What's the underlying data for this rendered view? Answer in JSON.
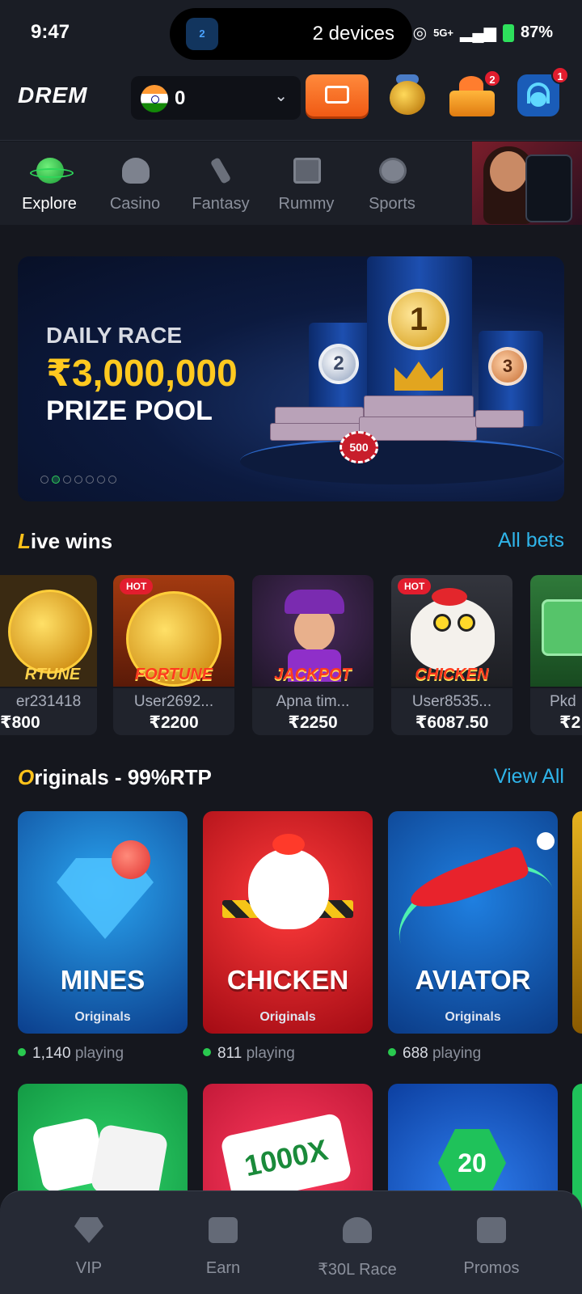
{
  "status_bar": {
    "time": "9:47",
    "island_text": "2 devices",
    "island_badge": "2",
    "network": "5G+",
    "battery": "87%"
  },
  "header": {
    "logo": "DREM",
    "balance": "0",
    "jar_icon": "gold-jar-icon",
    "gift_badge": "2",
    "support_badge": "1"
  },
  "categories": [
    {
      "label": "Explore",
      "active": true
    },
    {
      "label": "Casino",
      "active": false
    },
    {
      "label": "Fantasy",
      "active": false
    },
    {
      "label": "Rummy",
      "active": false
    },
    {
      "label": "Sports",
      "active": false
    }
  ],
  "banner": {
    "line1": "DAILY RACE",
    "line2": "₹3,000,000",
    "line3": "PRIZE POOL",
    "medals": [
      "1",
      "2",
      "3"
    ],
    "chip": "500",
    "slide_count": 7,
    "active_slide": 2
  },
  "live_wins": {
    "title_first": "L",
    "title_rest": "ive wins",
    "link": "All bets",
    "items": [
      {
        "user": "er231418",
        "amount": "₹800",
        "hot": "",
        "game_text": "RTUNE"
      },
      {
        "user": "User2692...",
        "amount": "₹2200",
        "hot": "HOT",
        "game_text": "FORTUNE"
      },
      {
        "user": "Apna tim...",
        "amount": "₹2250",
        "hot": "",
        "game_text": "JACKPOT"
      },
      {
        "user": "User8535...",
        "amount": "₹6087.50",
        "hot": "HOT",
        "game_text": "CHICKEN"
      },
      {
        "user": "Pkd",
        "amount": "₹2",
        "hot": "",
        "game_text": ""
      }
    ]
  },
  "originals": {
    "title_first": "O",
    "title_rest": "riginals - 99%RTP",
    "link": "View All",
    "games": [
      {
        "name": "MINES",
        "sub": "Originals",
        "count": "1,140",
        "playing": "playing"
      },
      {
        "name": "CHICKEN",
        "sub": "Originals",
        "count": "811",
        "playing": "playing"
      },
      {
        "name": "AVIATOR",
        "sub": "Originals",
        "count": "688",
        "playing": "playing"
      }
    ],
    "row2": [
      {
        "label": ""
      },
      {
        "label": "1000X"
      },
      {
        "label": "20"
      }
    ]
  },
  "bottom_nav": [
    {
      "label": "VIP",
      "icon": "diamond-icon"
    },
    {
      "label": "Earn",
      "icon": "earn-icon"
    },
    {
      "label": "₹30L Race",
      "icon": "trophy-icon"
    },
    {
      "label": "Promos",
      "icon": "gift-icon"
    }
  ],
  "colors": {
    "accent_blue": "#2fb4e9",
    "accent_gold": "#ffc21a",
    "online_green": "#29c94f",
    "badge_red": "#e21d2e"
  }
}
